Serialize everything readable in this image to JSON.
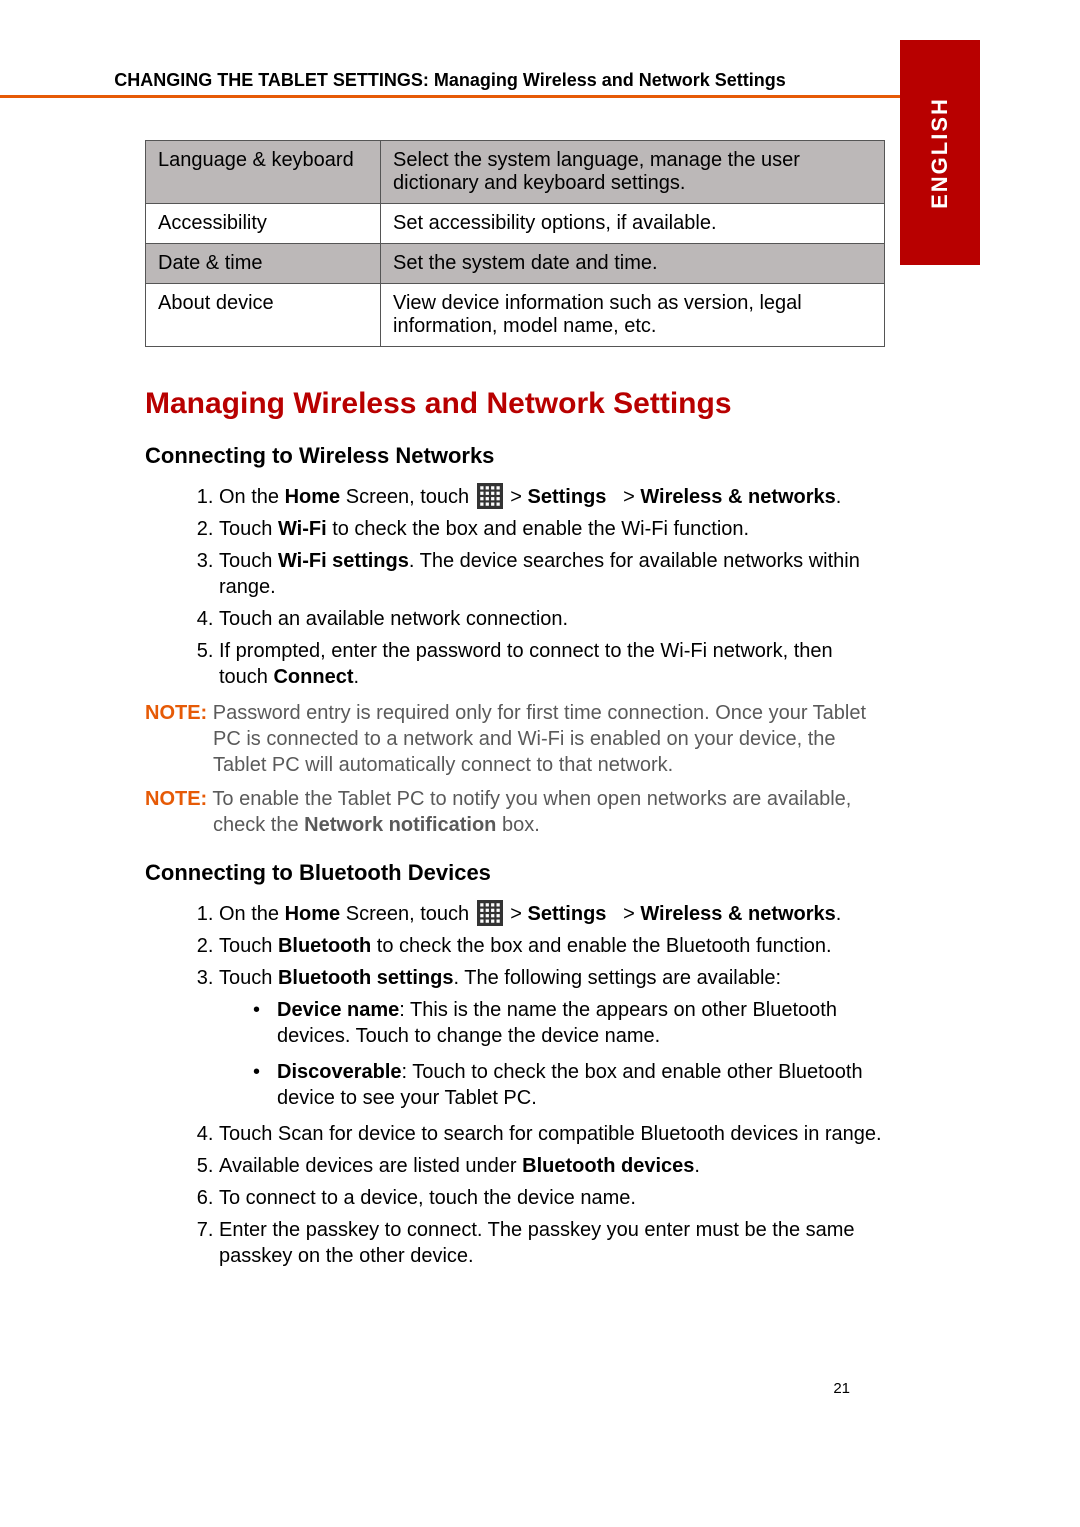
{
  "header": {
    "breadcrumb": "CHANGING THE TABLET SETTINGS: Managing Wireless and Network Settings",
    "language_tab": "ENGLISH"
  },
  "table": {
    "rows": [
      {
        "name": "Language & keyboard",
        "desc": "Select the system language, manage the user dictionary and keyboard settings."
      },
      {
        "name": "Accessibility",
        "desc": "Set accessibility options, if available."
      },
      {
        "name": "Date & time",
        "desc": "Set the system date and time."
      },
      {
        "name": "About device",
        "desc": "View device information such as version, legal information, model name, etc."
      }
    ]
  },
  "section": {
    "title": "Managing Wireless and Network Settings"
  },
  "wifi": {
    "heading": "Connecting to Wireless Networks",
    "step1_a": "On the ",
    "step1_home": "Home",
    "step1_b": " Screen, touch ",
    "step1_gt1": " > ",
    "step1_settings": "Settings",
    "step1_gt2": "   > ",
    "step1_wn": "Wireless & networks",
    "step1_end": ".",
    "step2_a": "Touch ",
    "step2_bold": "Wi-Fi",
    "step2_b": " to check the box and enable the Wi-Fi function.",
    "step3_a": "Touch ",
    "step3_bold": "Wi-Fi settings",
    "step3_b": ". The device searches for available networks within range.",
    "step4": "Touch an available network connection.",
    "step5_a": "If prompted, enter the password to connect to the Wi-Fi network, then touch ",
    "step5_bold": "Connect",
    "step5_b": ".",
    "note1_label": "NOTE:",
    "note1_text": " Password entry is required only for first time connection. Once your Tablet PC is connected to a network and Wi-Fi is enabled on your device, the Tablet PC will automatically connect to that network.",
    "note2_label": "NOTE:",
    "note2_a": " To enable the Tablet PC to notify you when open networks are available, check the ",
    "note2_bold": "Network notification",
    "note2_b": " box."
  },
  "bt": {
    "heading": "Connecting to Bluetooth Devices",
    "step1_a": "On the ",
    "step1_home": "Home",
    "step1_b": " Screen, touch ",
    "step1_gt1": " > ",
    "step1_settings": "Settings",
    "step1_gt2": "   > ",
    "step1_wn": "Wireless & networks",
    "step1_end": ".",
    "step2_a": "Touch ",
    "step2_bold": "Bluetooth",
    "step2_b": " to check the box and enable the Bluetooth function.",
    "step3_a": "Touch ",
    "step3_bold": "Bluetooth settings",
    "step3_b": ". The following settings are available:",
    "sub1_bold": "Device name",
    "sub1_text": ": This is the name the appears on other Bluetooth devices. Touch to change the device name.",
    "sub2_bold": "Discoverable",
    "sub2_text": ": Touch to check the box and enable other Bluetooth device to see your Tablet PC.",
    "step4": "Touch Scan for device to search for compatible Bluetooth devices in range.",
    "step5_a": "Available devices are listed under ",
    "step5_bold": "Bluetooth devices",
    "step5_b": ".",
    "step6": "To connect to a device, touch the device name.",
    "step7": "Enter the passkey to connect. The passkey you enter must be the same passkey on the other device."
  },
  "page_number": "21"
}
